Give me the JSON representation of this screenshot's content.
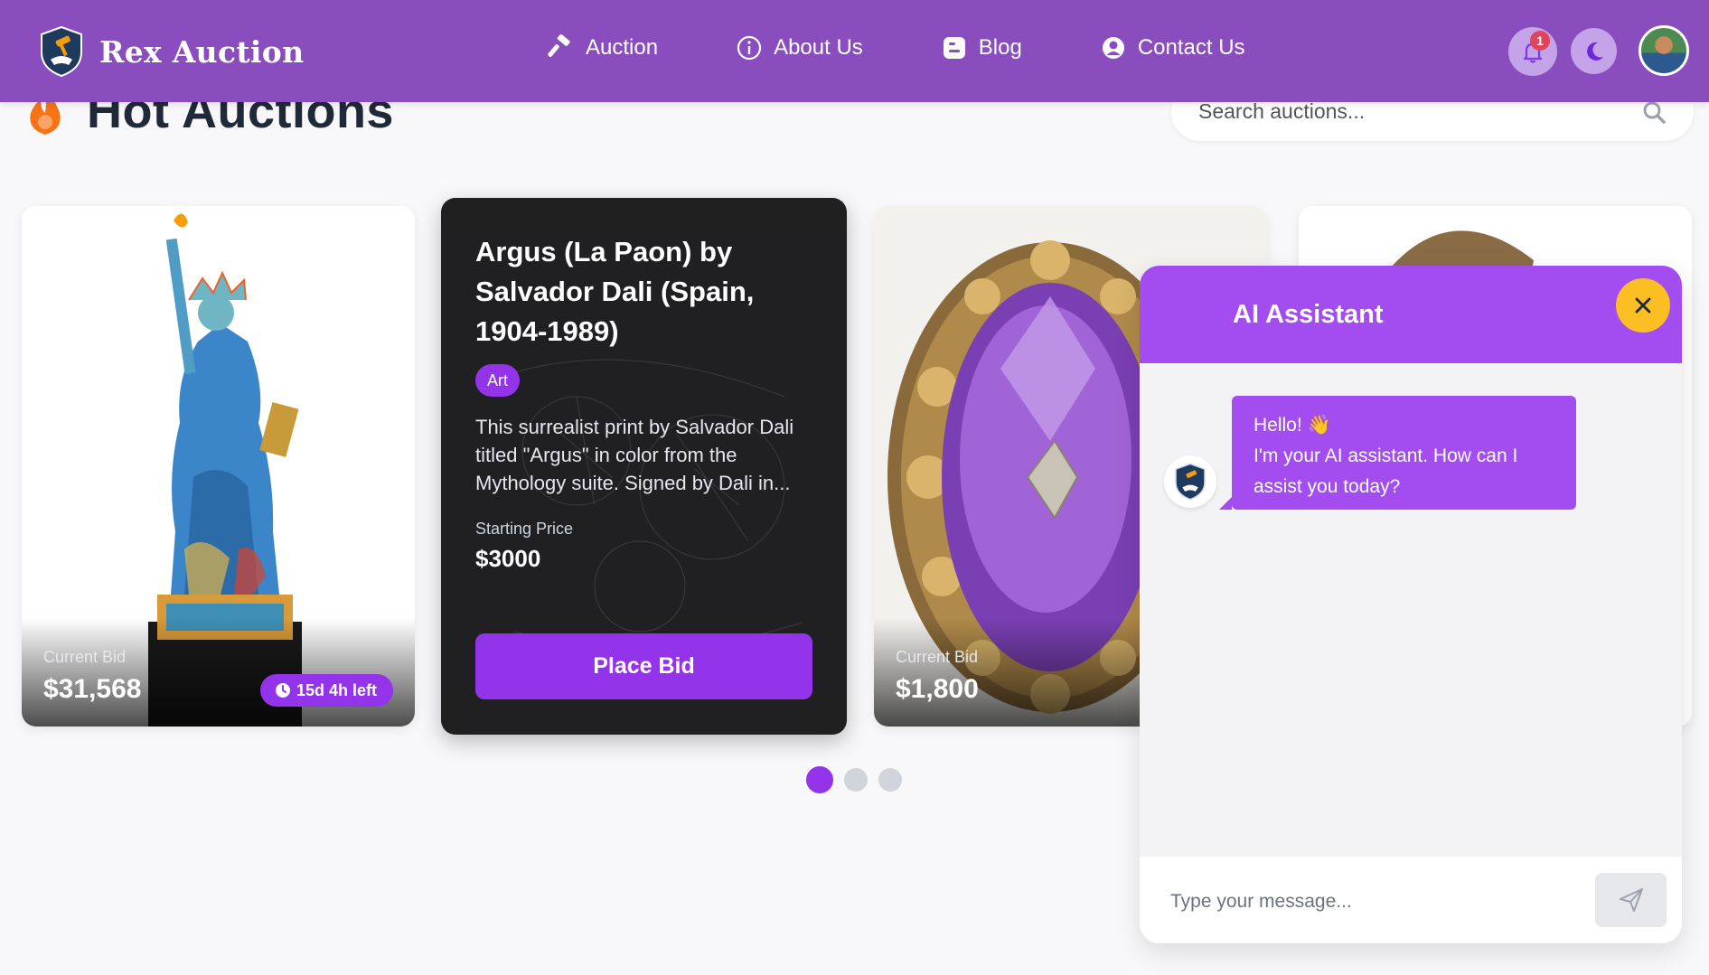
{
  "brand": {
    "name": "Rex Auction"
  },
  "nav": {
    "items": [
      {
        "label": "Auction",
        "icon": "gavel-icon"
      },
      {
        "label": "About Us",
        "icon": "info-icon"
      },
      {
        "label": "Blog",
        "icon": "blog-icon"
      },
      {
        "label": "Contact Us",
        "icon": "user-circle-icon"
      }
    ],
    "notification_count": "1"
  },
  "section": {
    "title": "Hot Auctions"
  },
  "search": {
    "placeholder": "Search auctions..."
  },
  "cards": [
    {
      "bid_label": "Current Bid",
      "bid_value": "$31,568",
      "time_left": "15d 4h left"
    },
    {
      "title": "Argus (La Paon) by Salvador Dali (Spain, 1904-1989)",
      "category": "Art",
      "description": "This surrealist print by Salvador Dali titled \"Argus\" in color from the Mythology suite. Signed by Dali in...",
      "price_label": "Starting Price",
      "price_value": "$3000",
      "button_label": "Place Bid"
    },
    {
      "bid_label": "Current Bid",
      "bid_value": "$1,800"
    }
  ],
  "carousel": {
    "pages": 3,
    "active": 0
  },
  "chat": {
    "title": "AI Assistant",
    "greeting": "Hello! 👋",
    "message": "I'm your AI assistant. How can I assist you today?",
    "input_placeholder": "Type your message..."
  },
  "colors": {
    "navbar": "#8a4dbd",
    "accent": "#9333ea",
    "chat_header": "#a34df0",
    "close_button": "#fbbf24",
    "flame": "#f97316"
  }
}
